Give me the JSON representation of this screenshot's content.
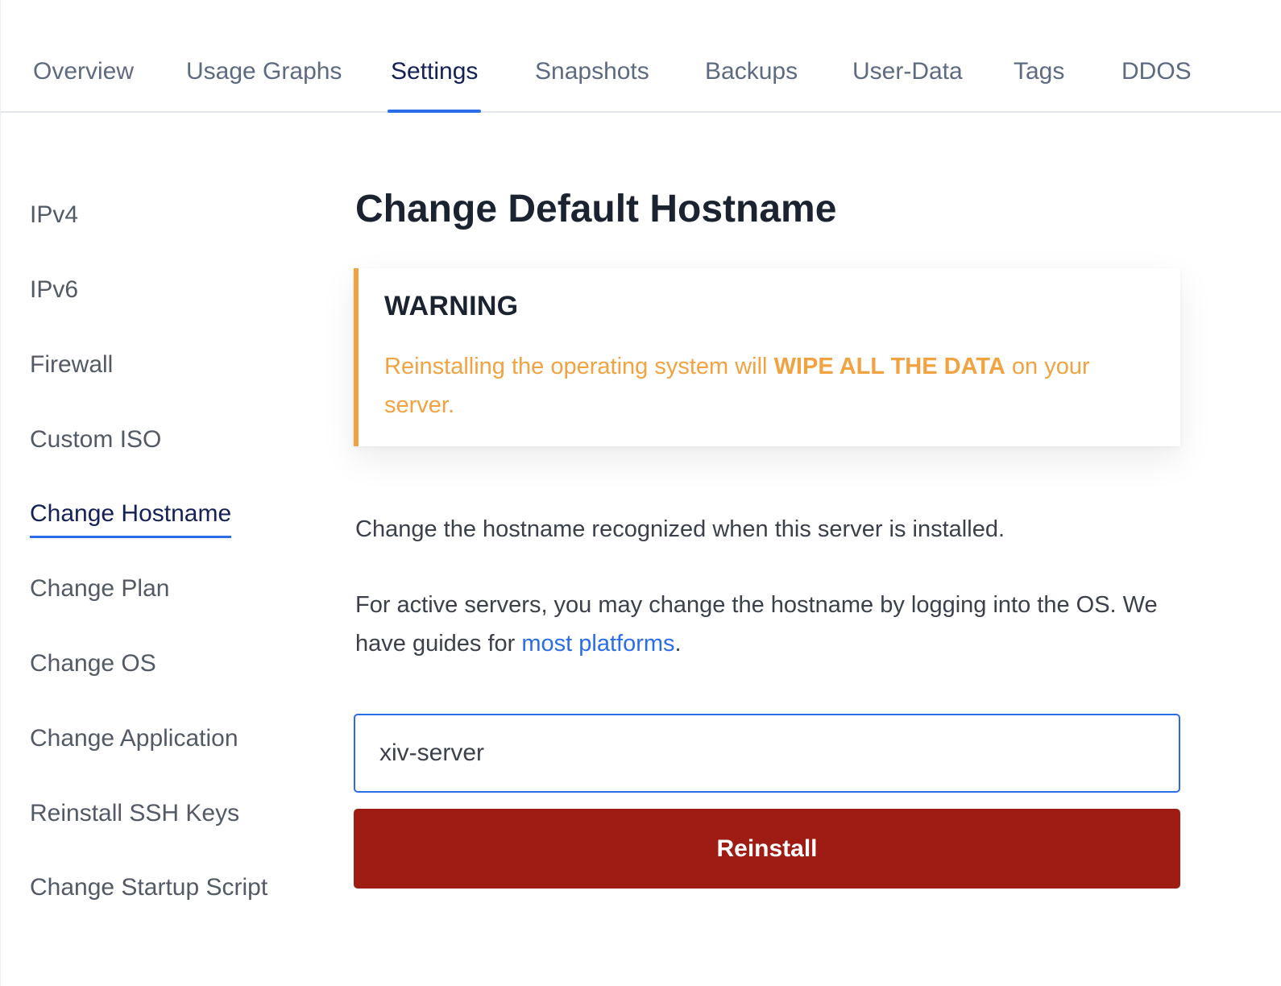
{
  "tabs": [
    {
      "label": "Overview"
    },
    {
      "label": "Usage Graphs"
    },
    {
      "label": "Settings",
      "active": true
    },
    {
      "label": "Snapshots"
    },
    {
      "label": "Backups"
    },
    {
      "label": "User-Data"
    },
    {
      "label": "Tags"
    },
    {
      "label": "DDOS"
    }
  ],
  "sidebar": {
    "items": [
      {
        "label": "IPv4"
      },
      {
        "label": "IPv6"
      },
      {
        "label": "Firewall"
      },
      {
        "label": "Custom ISO"
      },
      {
        "label": "Change Hostname",
        "active": true
      },
      {
        "label": "Change Plan"
      },
      {
        "label": "Change OS"
      },
      {
        "label": "Change Application"
      },
      {
        "label": "Reinstall SSH Keys"
      },
      {
        "label": "Change Startup Script"
      }
    ]
  },
  "main": {
    "title": "Change Default Hostname",
    "warning": {
      "title": "WARNING",
      "text_before": "Reinstalling the operating system will ",
      "text_bold": "WIPE ALL THE DATA",
      "text_after": " on your server."
    },
    "description": "Change the hostname recognized when this server is installed.",
    "guide_before": "For active servers, you may change the hostname by logging into the OS. We have guides for ",
    "guide_link": "most platforms",
    "guide_after": ".",
    "hostname_value": "xiv-server",
    "reinstall_label": "Reinstall"
  },
  "colors": {
    "accent": "#2b6de8",
    "active_text": "#142157",
    "warning": "#f2a341",
    "danger": "#9e1c13"
  }
}
